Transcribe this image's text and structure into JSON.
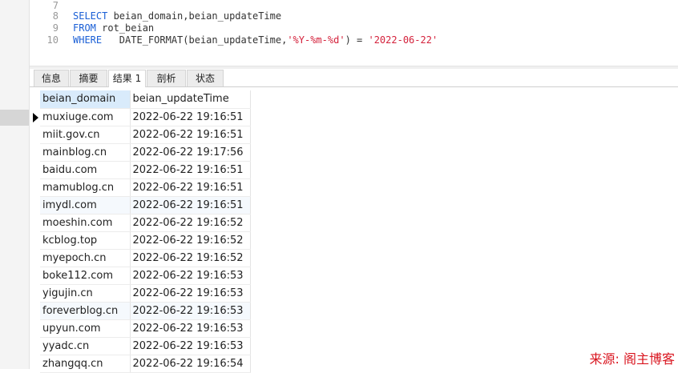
{
  "editor": {
    "lines": [
      {
        "num": "7",
        "parts": []
      },
      {
        "num": "8",
        "parts": [
          {
            "t": "SELECT",
            "c": "kw"
          },
          {
            "t": " beian_domain,beian_updateTime",
            "c": ""
          }
        ]
      },
      {
        "num": "9",
        "parts": [
          {
            "t": "FROM",
            "c": "kw"
          },
          {
            "t": " rot_beian",
            "c": ""
          }
        ]
      },
      {
        "num": "10",
        "parts": [
          {
            "t": "WHERE",
            "c": "kw"
          },
          {
            "t": "   DATE_FORMAT(beian_updateTime,",
            "c": ""
          },
          {
            "t": "'%Y-%m-%d'",
            "c": "str"
          },
          {
            "t": ") = ",
            "c": ""
          },
          {
            "t": "'2022-06-22'",
            "c": "str"
          }
        ]
      }
    ]
  },
  "tabs": [
    {
      "label": "信息"
    },
    {
      "label": "摘要"
    },
    {
      "label": "结果 1"
    },
    {
      "label": "剖析"
    },
    {
      "label": "状态"
    }
  ],
  "grid": {
    "columns": [
      "beian_domain",
      "beian_updateTime"
    ],
    "rows": [
      [
        "muxiuge.com",
        "2022-06-22 19:16:51"
      ],
      [
        "miit.gov.cn",
        "2022-06-22 19:16:51"
      ],
      [
        "mainblog.cn",
        "2022-06-22 19:17:56"
      ],
      [
        "baidu.com",
        "2022-06-22 19:16:51"
      ],
      [
        "mamublog.cn",
        "2022-06-22 19:16:51"
      ],
      [
        "imydl.com",
        "2022-06-22 19:16:51"
      ],
      [
        "moeshin.com",
        "2022-06-22 19:16:52"
      ],
      [
        "kcblog.top",
        "2022-06-22 19:16:52"
      ],
      [
        "myepoch.cn",
        "2022-06-22 19:16:52"
      ],
      [
        "boke112.com",
        "2022-06-22 19:16:53"
      ],
      [
        "yigujin.cn",
        "2022-06-22 19:16:53"
      ],
      [
        "foreverblog.cn",
        "2022-06-22 19:16:53"
      ],
      [
        "upyun.com",
        "2022-06-22 19:16:53"
      ],
      [
        "yyadc.cn",
        "2022-06-22 19:16:53"
      ],
      [
        "zhangqq.cn",
        "2022-06-22 19:16:54"
      ]
    ]
  },
  "watermark": "来源: 阁主博客",
  "colors": {
    "keyword": "#1a5fd6",
    "string": "#d4213b",
    "watermark": "#d9141e",
    "selected_header": "#d9ebfb"
  }
}
